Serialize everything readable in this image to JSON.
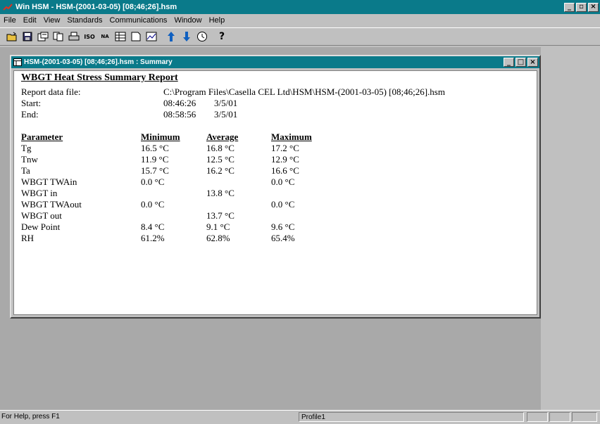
{
  "app": {
    "title": "Win HSM - HSM-(2001-03-05) [08;46;26].hsm"
  },
  "menu": [
    "File",
    "Edit",
    "View",
    "Standards",
    "Communications",
    "Window",
    "Help"
  ],
  "toolbar": {
    "iso_label": "ISO",
    "na_label": "NA"
  },
  "child_window": {
    "title": "HSM-(2001-03-05) [08;46;26].hsm : Summary"
  },
  "report": {
    "title": "WBGT Heat Stress Summary Report",
    "file_label": "Report data file:",
    "file_value": "C:\\Program Files\\Casella CEL Ltd\\HSM\\HSM-(2001-03-05) [08;46;26].hsm",
    "start_label": "Start:",
    "start_time": "08:46:26",
    "start_date": "3/5/01",
    "end_label": "End:",
    "end_time": "08:58:56",
    "end_date": "3/5/01",
    "columns": [
      "Parameter",
      "Minimum",
      "Average",
      "Maximum"
    ],
    "rows": [
      {
        "param": "Tg",
        "min": "16.5 °C",
        "avg": "16.8 °C",
        "max": "17.2 °C"
      },
      {
        "param": "Tnw",
        "min": "11.9 °C",
        "avg": "12.5 °C",
        "max": "12.9 °C"
      },
      {
        "param": "Ta",
        "min": "15.7 °C",
        "avg": "16.2 °C",
        "max": "16.6 °C"
      },
      {
        "param": "WBGT TWAin",
        "min": "0.0 °C",
        "avg": "",
        "max": "0.0 °C"
      },
      {
        "param": "WBGT in",
        "min": "",
        "avg": "13.8 °C",
        "max": ""
      },
      {
        "param": "WBGT TWAout",
        "min": "0.0 °C",
        "avg": "",
        "max": "0.0 °C"
      },
      {
        "param": "WBGT out",
        "min": "",
        "avg": "13.7 °C",
        "max": ""
      },
      {
        "param": "Dew Point",
        "min": "8.4 °C",
        "avg": "9.1 °C",
        "max": "9.6 °C"
      },
      {
        "param": "RH",
        "min": "61.2%",
        "avg": "62.8%",
        "max": "65.4%"
      }
    ]
  },
  "status": {
    "help": "For Help, press F1",
    "profile": "Profile1"
  }
}
